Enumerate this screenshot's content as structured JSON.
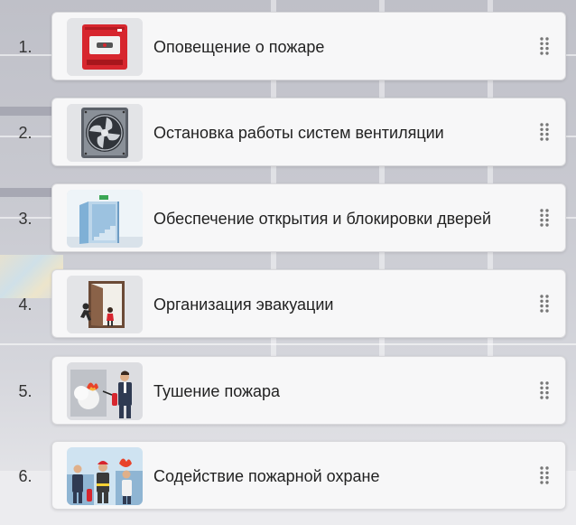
{
  "items": [
    {
      "number": "1.",
      "label": "Оповещение о пожаре",
      "icon": "fire-alarm-icon"
    },
    {
      "number": "2.",
      "label": "Остановка работы систем вентиляции",
      "icon": "ventilation-fan-icon"
    },
    {
      "number": "3.",
      "label": "Обеспечение открытия и блокировки дверей",
      "icon": "exit-door-icon"
    },
    {
      "number": "4.",
      "label": "Организация эвакуации",
      "icon": "evacuation-icon"
    },
    {
      "number": "5.",
      "label": "Тушение пожара",
      "icon": "fire-extinguishing-icon"
    },
    {
      "number": "6.",
      "label": "Содействие пожарной охране",
      "icon": "firefighters-icon"
    }
  ],
  "grip_icon": "drag-handle-icon",
  "colors": {
    "card_bg": "#f7f7f8",
    "card_border": "#d9d9dc",
    "alarm_red": "#d7262e"
  }
}
